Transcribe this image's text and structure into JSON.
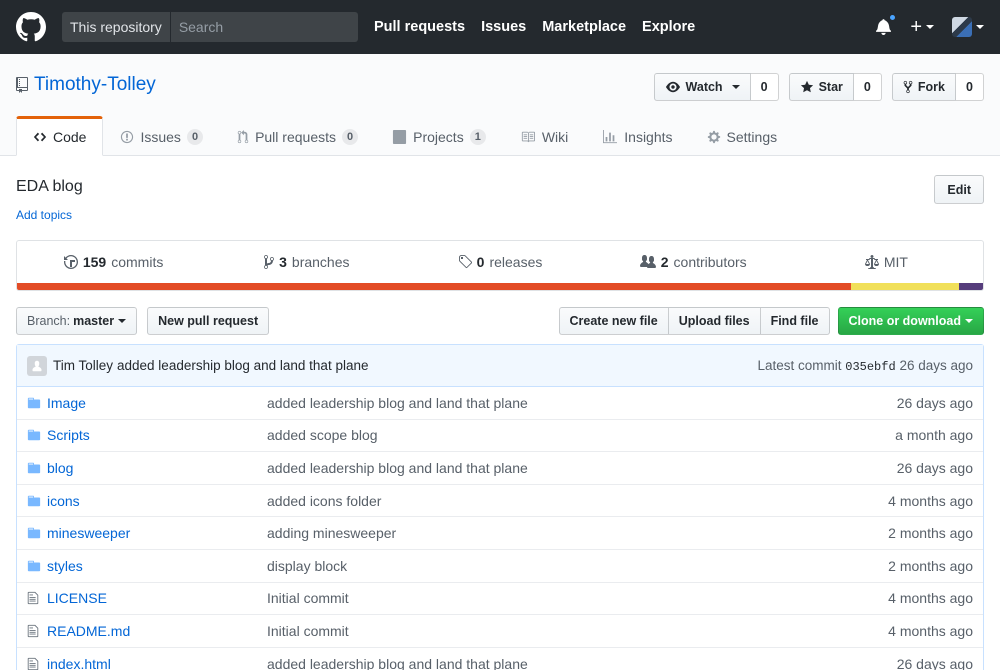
{
  "header": {
    "search_scope": "This repository",
    "search_placeholder": "Search",
    "nav": [
      "Pull requests",
      "Issues",
      "Marketplace",
      "Explore"
    ]
  },
  "repo": {
    "name": "Timothy-Tolley",
    "watch_label": "Watch",
    "watch_count": "0",
    "star_label": "Star",
    "star_count": "0",
    "fork_label": "Fork",
    "fork_count": "0"
  },
  "tabs": [
    {
      "label": "Code",
      "icon": "code-icon"
    },
    {
      "label": "Issues",
      "counter": "0",
      "icon": "issue-icon"
    },
    {
      "label": "Pull requests",
      "counter": "0",
      "icon": "git-pull-request-icon"
    },
    {
      "label": "Projects",
      "counter": "1",
      "icon": "project-icon"
    },
    {
      "label": "Wiki",
      "icon": "book-icon"
    },
    {
      "label": "Insights",
      "icon": "graph-icon"
    },
    {
      "label": "Settings",
      "icon": "gear-icon"
    }
  ],
  "description": "EDA blog",
  "add_topics": "Add topics",
  "edit_label": "Edit",
  "summary": {
    "commits_num": "159",
    "commits_label": "commits",
    "branches_num": "3",
    "branches_label": "branches",
    "releases_num": "0",
    "releases_label": "releases",
    "contributors_num": "2",
    "contributors_label": "contributors",
    "license": "MIT"
  },
  "language_colors": [
    "#e34c26",
    "#f1e05a",
    "#563d7c"
  ],
  "language_shares": [
    0.863,
    0.112,
    0.025
  ],
  "file_nav": {
    "branch_prefix": "Branch:",
    "branch": "master",
    "new_pr": "New pull request",
    "create_file": "Create new file",
    "upload": "Upload files",
    "find": "Find file",
    "clone": "Clone or download"
  },
  "latest_commit": {
    "author": "Tim Tolley",
    "message": "added leadership blog and land that plane",
    "prefix": "Latest commit",
    "sha": "035ebfd",
    "age": "26 days ago"
  },
  "files": [
    {
      "type": "dir",
      "name": "Image",
      "message": "added leadership blog and land that plane",
      "age": "26 days ago"
    },
    {
      "type": "dir",
      "name": "Scripts",
      "message": "added scope blog",
      "age": "a month ago"
    },
    {
      "type": "dir",
      "name": "blog",
      "message": "added leadership blog and land that plane",
      "age": "26 days ago"
    },
    {
      "type": "dir",
      "name": "icons",
      "message": "added icons folder",
      "age": "4 months ago"
    },
    {
      "type": "dir",
      "name": "minesweeper",
      "message": "adding minesweeper",
      "age": "2 months ago"
    },
    {
      "type": "dir",
      "name": "styles",
      "message": "display block",
      "age": "2 months ago"
    },
    {
      "type": "file",
      "name": "LICENSE",
      "message": "Initial commit",
      "age": "4 months ago"
    },
    {
      "type": "file",
      "name": "README.md",
      "message": "Initial commit",
      "age": "4 months ago"
    },
    {
      "type": "file",
      "name": "index.html",
      "message": "added leadership blog and land that plane",
      "age": "26 days ago"
    }
  ]
}
